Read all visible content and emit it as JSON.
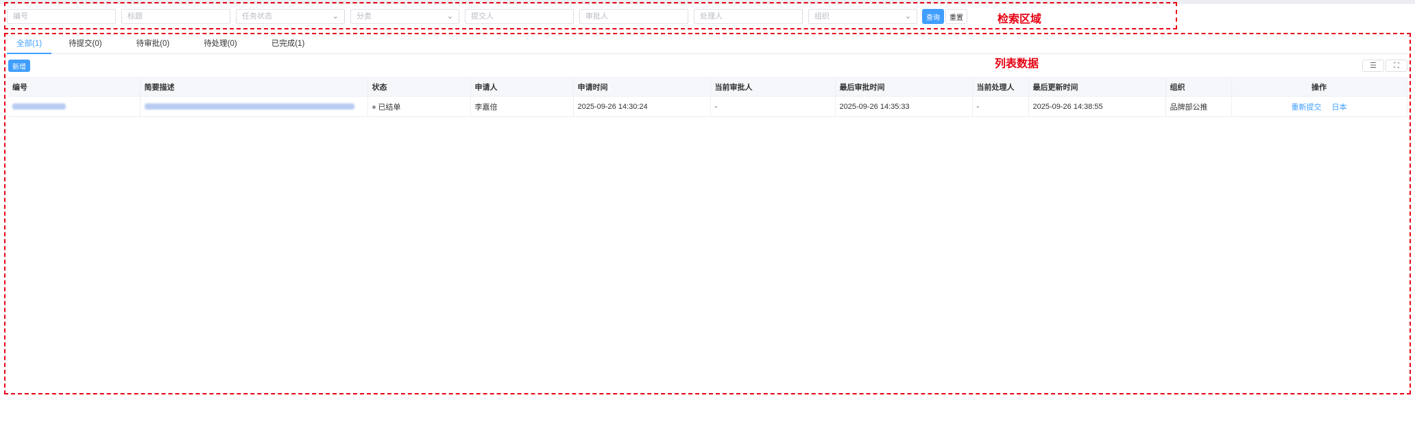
{
  "search": {
    "annotation": "检索区域",
    "fields": [
      {
        "placeholder": "编号",
        "type": "input"
      },
      {
        "placeholder": "标题",
        "type": "input"
      },
      {
        "placeholder": "任务状态",
        "type": "select"
      },
      {
        "placeholder": "分类",
        "type": "select"
      },
      {
        "placeholder": "提交人",
        "type": "input"
      },
      {
        "placeholder": "审批人",
        "type": "input"
      },
      {
        "placeholder": "处理人",
        "type": "input"
      },
      {
        "placeholder": "组织",
        "type": "select"
      }
    ],
    "query_label": "查询",
    "reset_label": "重置"
  },
  "list": {
    "annotation": "列表数据",
    "tabs": [
      {
        "label": "全部(1)",
        "active": true
      },
      {
        "label": "待提交(0)",
        "active": false
      },
      {
        "label": "待审批(0)",
        "active": false
      },
      {
        "label": "待处理(0)",
        "active": false
      },
      {
        "label": "已完成(1)",
        "active": false
      }
    ],
    "new_label": "新增",
    "tools": [
      "list-icon",
      "fullscreen-icon"
    ],
    "columns": [
      "编号",
      "简要描述",
      "状态",
      "申请人",
      "申请时间",
      "当前审批人",
      "最后审批时间",
      "当前处理人",
      "最后更新时间",
      "组织",
      "操作"
    ],
    "rows": [
      {
        "status": "已结单",
        "applicant": "李嘉倍",
        "apply_time": "2025-09-26 14:30:24",
        "current_approver": "-",
        "last_approve_time": "2025-09-26 14:35:33",
        "current_handler": "-",
        "last_update_time": "2025-09-26 14:38:55",
        "org": "品牌部公推",
        "actions": [
          "重新提交",
          "日本"
        ]
      }
    ]
  },
  "colors": {
    "accent": "#409eff",
    "annotation": "#e60012"
  }
}
